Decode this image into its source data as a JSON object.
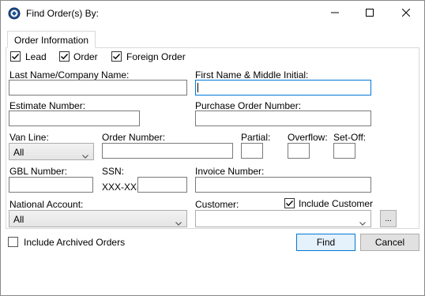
{
  "window": {
    "title": "Find Order(s) By:"
  },
  "tabs": [
    {
      "label": "Order Information"
    }
  ],
  "order_types": {
    "lead": {
      "label": "Lead",
      "checked": true
    },
    "order": {
      "label": "Order",
      "checked": true
    },
    "foreign_order": {
      "label": "Foreign Order",
      "checked": true
    }
  },
  "fields": {
    "last_name": {
      "label": "Last Name/Company Name:",
      "value": ""
    },
    "first_name": {
      "label": "First Name & Middle Initial:",
      "value": ""
    },
    "estimate_number": {
      "label": "Estimate Number:",
      "value": ""
    },
    "purchase_order_number": {
      "label": "Purchase Order Number:",
      "value": ""
    },
    "van_line": {
      "label": "Van Line:",
      "value": "All"
    },
    "order_number": {
      "label": "Order Number:",
      "value": ""
    },
    "partial": {
      "label": "Partial:",
      "value": ""
    },
    "overflow": {
      "label": "Overflow:",
      "value": ""
    },
    "set_off": {
      "label": "Set-Off:",
      "value": ""
    },
    "gbl_number": {
      "label": "GBL Number:",
      "value": ""
    },
    "ssn": {
      "label": "SSN:",
      "prefix": "XXX-XX-",
      "value": ""
    },
    "invoice_number": {
      "label": "Invoice Number:",
      "value": ""
    },
    "national_account": {
      "label": "National Account:",
      "value": "All"
    },
    "customer": {
      "label": "Customer:",
      "value": ""
    },
    "include_customer": {
      "label": "Include Customer",
      "checked": true
    },
    "customer_browse": {
      "label": "..."
    }
  },
  "footer": {
    "include_archived": {
      "label": "Include Archived Orders",
      "checked": false
    },
    "find_label": "Find",
    "cancel_label": "Cancel"
  },
  "colors": {
    "focus_border": "#0078d7",
    "default_button_bg": "#e5f1fb"
  }
}
